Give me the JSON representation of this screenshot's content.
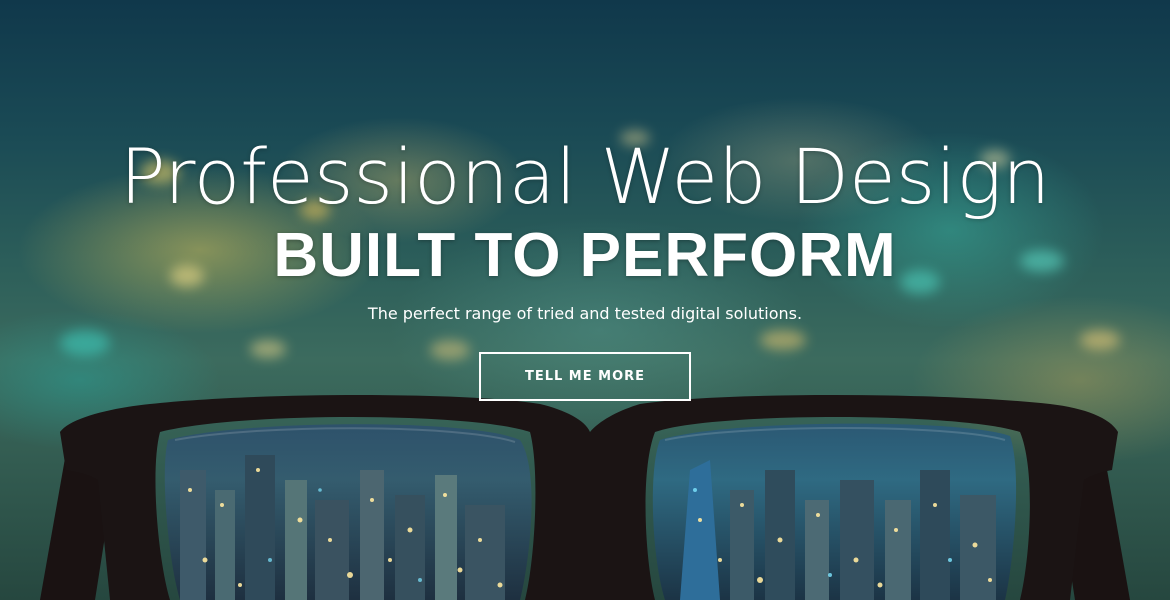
{
  "hero": {
    "headline_light": "Professional Web Design",
    "headline_bold": "BUILT TO PERFORM",
    "subtitle": "The perfect range of tried and tested digital solutions.",
    "cta_label": "TELL ME MORE"
  },
  "colors": {
    "text": "#ffffff",
    "frame": "#1b1414",
    "sky_top": "#10384b",
    "city_glow": "#d2be5a",
    "teal_glow": "#3cbeaa"
  }
}
